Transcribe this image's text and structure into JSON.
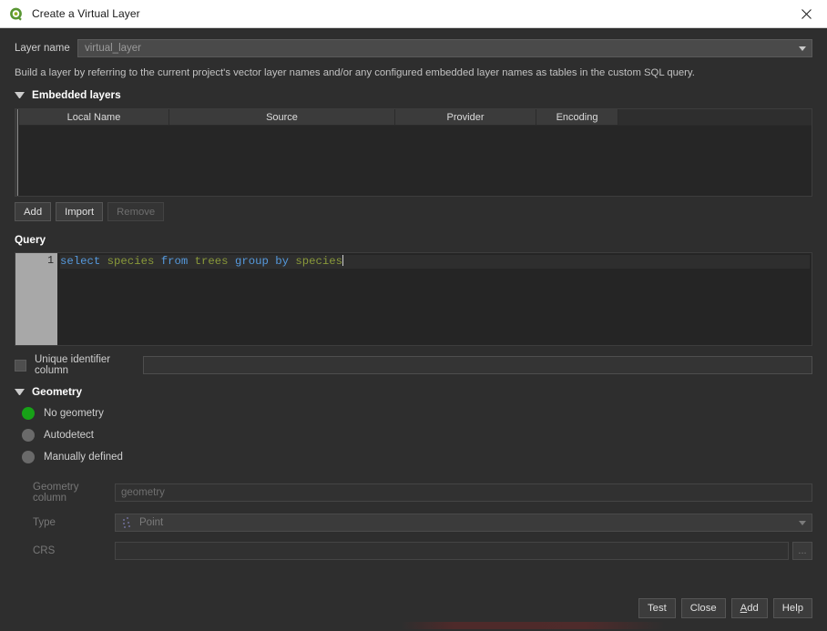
{
  "window": {
    "title": "Create a Virtual Layer",
    "icon": "qgis-logo-icon",
    "close_label": "✕"
  },
  "layer_name": {
    "label": "Layer name",
    "value": "virtual_layer"
  },
  "description": "Build a layer by referring to the current project's vector layer names and/or any configured embedded layer names as tables in the custom SQL query.",
  "embedded_layers": {
    "section_title": "Embedded layers",
    "columns": [
      "Local Name",
      "Source",
      "Provider",
      "Encoding"
    ],
    "rows": [],
    "buttons": {
      "add": "Add",
      "import": "Import",
      "remove": "Remove"
    }
  },
  "query": {
    "label": "Query",
    "line_number": "1",
    "tokens": [
      {
        "text": "select",
        "type": "keyword"
      },
      {
        "text": " ",
        "type": "plain"
      },
      {
        "text": "species",
        "type": "identifier"
      },
      {
        "text": " ",
        "type": "plain"
      },
      {
        "text": "from",
        "type": "keyword"
      },
      {
        "text": " ",
        "type": "plain"
      },
      {
        "text": "trees",
        "type": "identifier"
      },
      {
        "text": " ",
        "type": "plain"
      },
      {
        "text": "group",
        "type": "keyword"
      },
      {
        "text": " ",
        "type": "plain"
      },
      {
        "text": "by",
        "type": "keyword"
      },
      {
        "text": " ",
        "type": "plain"
      },
      {
        "text": "species",
        "type": "identifier"
      }
    ],
    "sql_text": "select species from trees group by species",
    "keyword_color": "#5599dd",
    "identifier_color": "#8a9a3a"
  },
  "unique_id": {
    "label": "Unique identifier column",
    "checked": false,
    "value": ""
  },
  "geometry": {
    "section_title": "Geometry",
    "options": [
      {
        "label": "No geometry",
        "selected": true
      },
      {
        "label": "Autodetect",
        "selected": false
      },
      {
        "label": "Manually defined",
        "selected": false
      }
    ],
    "selected_color": "#17a117",
    "geometry_column": {
      "label": "Geometry column",
      "placeholder": "geometry",
      "value": ""
    },
    "type": {
      "label": "Type",
      "value": "Point"
    },
    "crs": {
      "label": "CRS",
      "value": "",
      "browse_label": "..."
    }
  },
  "footer": {
    "test": "Test",
    "close": "Close",
    "add_prefix": "A",
    "add_suffix": "dd",
    "help": "Help"
  }
}
